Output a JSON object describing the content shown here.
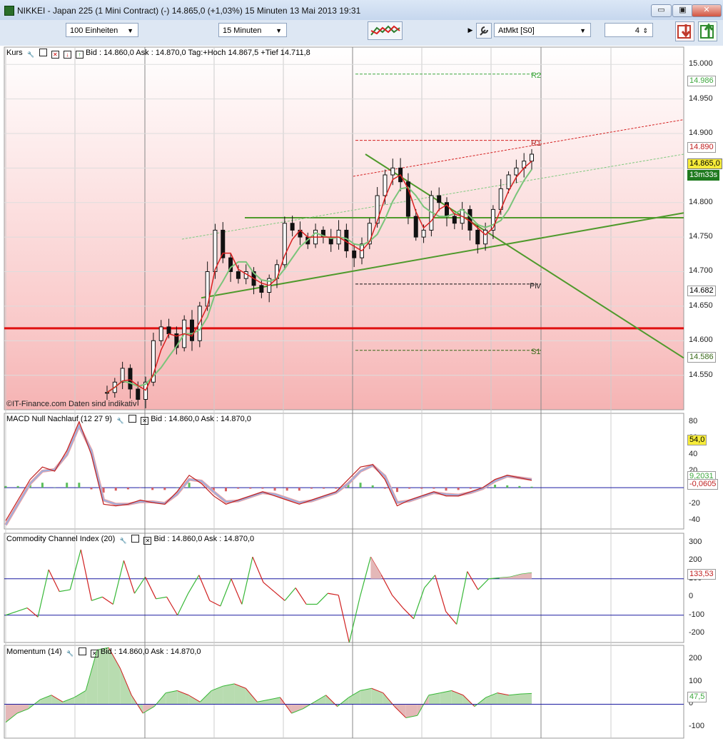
{
  "window": {
    "title": "NIKKEI - Japan 225 (1 Mini Contract) (-)    14.865,0 (+1,03%)    15 Minuten  13 Mai 2013 19:31",
    "btn_minimize": "▭",
    "btn_restore": "▣",
    "btn_close": "✕"
  },
  "toolbar": {
    "units": "100 Einheiten",
    "interval": "15 Minuten",
    "order_type": "AtMkt [S0]",
    "quantity": "4",
    "spin": "⇕"
  },
  "colors": {
    "up": "#2e7d2e",
    "down": "#d92020",
    "pivot_red": "#d42020",
    "pivot_green": "#3fa83f",
    "trend": "#4f9a2c",
    "accent_yellow": "#f7ec3a"
  },
  "panels": {
    "price": {
      "name": "Kurs",
      "info": "Bid : 14.860,0 Ask : 14.870,0 Tag:+Hoch 14.867,5 +Tief 14.711,8",
      "ticks": [
        "15.000",
        "14.950",
        "14.900",
        "14.850",
        "14.800",
        "14.750",
        "14.700",
        "14.650",
        "14.600",
        "14.550"
      ],
      "badges": {
        "r2": "14.986",
        "r1": "14.890",
        "last": "14.865,0",
        "timer": "13m33s",
        "piv": "14.682",
        "s1": "14.586"
      },
      "pivot_labels": {
        "r2": "R2",
        "r1": "R1",
        "piv": "Piv",
        "s1": "S1"
      },
      "watermark": "©IT-Finance.com  Daten sind indikativ"
    },
    "macd": {
      "name": "MACD Null Nachlauf (12 27 9)",
      "info": "Bid : 14.860,0 Ask : 14.870,0",
      "ticks": [
        "80",
        "60",
        "40",
        "20",
        "0",
        "-20",
        "-40"
      ],
      "badges": {
        "top": "54,0",
        "v1": "9,2031",
        "v2": "-0,0605"
      }
    },
    "cci": {
      "name": "Commodity Channel Index (20)",
      "info": "Bid : 14.860,0 Ask : 14.870,0",
      "ticks": [
        "300",
        "200",
        "100",
        "0",
        "-100",
        "-200"
      ],
      "badges": {
        "value": "133,53"
      }
    },
    "momentum": {
      "name": "Momentum (14)",
      "info": "Bid : 14.860,0 Ask : 14.870,0",
      "ticks": [
        "200",
        "100",
        "0",
        "-100"
      ],
      "badges": {
        "value": "47,5"
      }
    }
  },
  "chart_data": [
    {
      "type": "candlestick",
      "title": "NIKKEI - Japan 225 (1 Mini Contract) 15 Minuten",
      "ylim": [
        14500,
        15025
      ],
      "pivots": {
        "R2": 14986,
        "R1": 14890,
        "Piv": 14682,
        "S1": 14586
      },
      "support_line": 14618,
      "close_path": [
        14525,
        14540,
        14560,
        14530,
        14515,
        14540,
        14600,
        14620,
        14610,
        14590,
        14630,
        14600,
        14650,
        14700,
        14760,
        14720,
        14700,
        14690,
        14700,
        14680,
        14670,
        14690,
        14710,
        14770,
        14760,
        14750,
        14740,
        14760,
        14750,
        14740,
        14760,
        14730,
        14720,
        14740,
        14770,
        14810,
        14840,
        14850,
        14830,
        14780,
        14750,
        14760,
        14810,
        14800,
        14780,
        14770,
        14790,
        14760,
        14740,
        14760,
        14790,
        14820,
        14840,
        14850,
        14860,
        14870
      ],
      "last": 14865
    },
    {
      "type": "line",
      "title": "MACD Null Nachlauf (12 27 9)",
      "ylim": [
        -50,
        90
      ],
      "series": [
        {
          "name": "MACD",
          "values": [
            -40,
            -15,
            10,
            25,
            20,
            45,
            80,
            40,
            -20,
            -22,
            -20,
            -15,
            -18,
            -20,
            -5,
            15,
            5,
            -10,
            -20,
            -15,
            -10,
            -5,
            -10,
            -15,
            -20,
            -15,
            -10,
            -5,
            10,
            25,
            28,
            10,
            -22,
            -15,
            -10,
            -5,
            -10,
            -10,
            -5,
            0,
            10,
            15,
            12,
            9
          ]
        },
        {
          "name": "Signal",
          "values": [
            -45,
            -20,
            5,
            20,
            22,
            40,
            75,
            45,
            -15,
            -20,
            -20,
            -17,
            -17,
            -19,
            -8,
            10,
            8,
            -5,
            -17,
            -16,
            -11,
            -6,
            -8,
            -13,
            -18,
            -16,
            -11,
            -6,
            5,
            20,
            27,
            14,
            -18,
            -16,
            -11,
            -6,
            -8,
            -9,
            -6,
            -1,
            8,
            14,
            12,
            10
          ]
        }
      ],
      "last": 9.2031,
      "histogram_last": -0.0605
    },
    {
      "type": "line",
      "title": "Commodity Channel Index (20)",
      "ylim": [
        -250,
        350
      ],
      "series": [
        {
          "name": "CCI",
          "values": [
            -100,
            -80,
            -60,
            -110,
            150,
            30,
            40,
            260,
            -20,
            0,
            -40,
            200,
            20,
            110,
            -10,
            0,
            -100,
            20,
            120,
            -20,
            -50,
            100,
            -40,
            220,
            80,
            30,
            -20,
            50,
            -40,
            -40,
            20,
            10,
            -250,
            0,
            220,
            120,
            10,
            -60,
            -120,
            50,
            120,
            -80,
            -150,
            140,
            40,
            100,
            105,
            110,
            125,
            133
          ]
        }
      ],
      "last": 133.53
    },
    {
      "type": "area",
      "title": "Momentum (14)",
      "ylim": [
        -150,
        260
      ],
      "series": [
        {
          "name": "Momentum",
          "values": [
            -80,
            -40,
            -20,
            20,
            40,
            10,
            30,
            60,
            240,
            250,
            160,
            40,
            -40,
            -10,
            50,
            60,
            40,
            10,
            60,
            80,
            90,
            70,
            10,
            20,
            30,
            -40,
            -20,
            10,
            40,
            -10,
            30,
            60,
            70,
            50,
            -10,
            -60,
            -50,
            40,
            50,
            60,
            40,
            -10,
            30,
            50,
            40,
            45,
            47.5
          ]
        }
      ],
      "last": 47.5
    }
  ]
}
